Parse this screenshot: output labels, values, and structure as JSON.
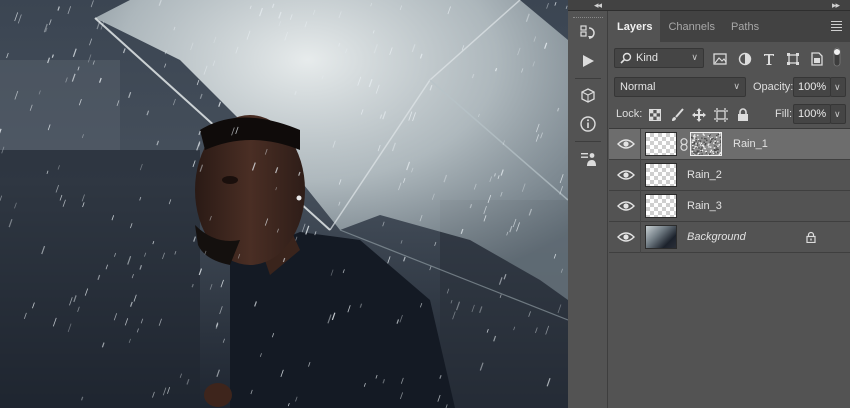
{
  "panel": {
    "tabs": [
      {
        "label": "Layers",
        "active": true
      },
      {
        "label": "Channels",
        "active": false
      },
      {
        "label": "Paths",
        "active": false
      }
    ],
    "filter": {
      "value": "Kind"
    },
    "blend_mode": {
      "value": "Normal"
    },
    "opacity": {
      "label": "Opacity:",
      "value": "100%"
    },
    "lock": {
      "label": "Lock:"
    },
    "fill": {
      "label": "Fill:",
      "value": "100%"
    },
    "layers": [
      {
        "name": "Rain_1",
        "visible": true,
        "selected": true,
        "has_mask": true
      },
      {
        "name": "Rain_2",
        "visible": true,
        "selected": false,
        "has_mask": false
      },
      {
        "name": "Rain_3",
        "visible": true,
        "selected": false,
        "has_mask": false
      },
      {
        "name": "Background",
        "visible": true,
        "selected": false,
        "locked": true
      }
    ]
  },
  "colors": {
    "panel_bg": "#535353",
    "tab_bar_bg": "#424242",
    "selected_layer": "#6d6d6d"
  },
  "icons": {
    "toolbar": [
      "history-icon",
      "play-actions-icon",
      "3d-cube-icon",
      "info-icon",
      "properties-icon"
    ],
    "filter": [
      "image-filter-icon",
      "adjustment-filter-icon",
      "type-filter-icon",
      "shape-filter-icon",
      "smart-object-filter-icon",
      "filter-toggle-icon"
    ],
    "lock": [
      "lock-transparent-icon",
      "lock-paint-icon",
      "lock-position-icon",
      "lock-artboard-icon",
      "lock-all-icon"
    ]
  }
}
